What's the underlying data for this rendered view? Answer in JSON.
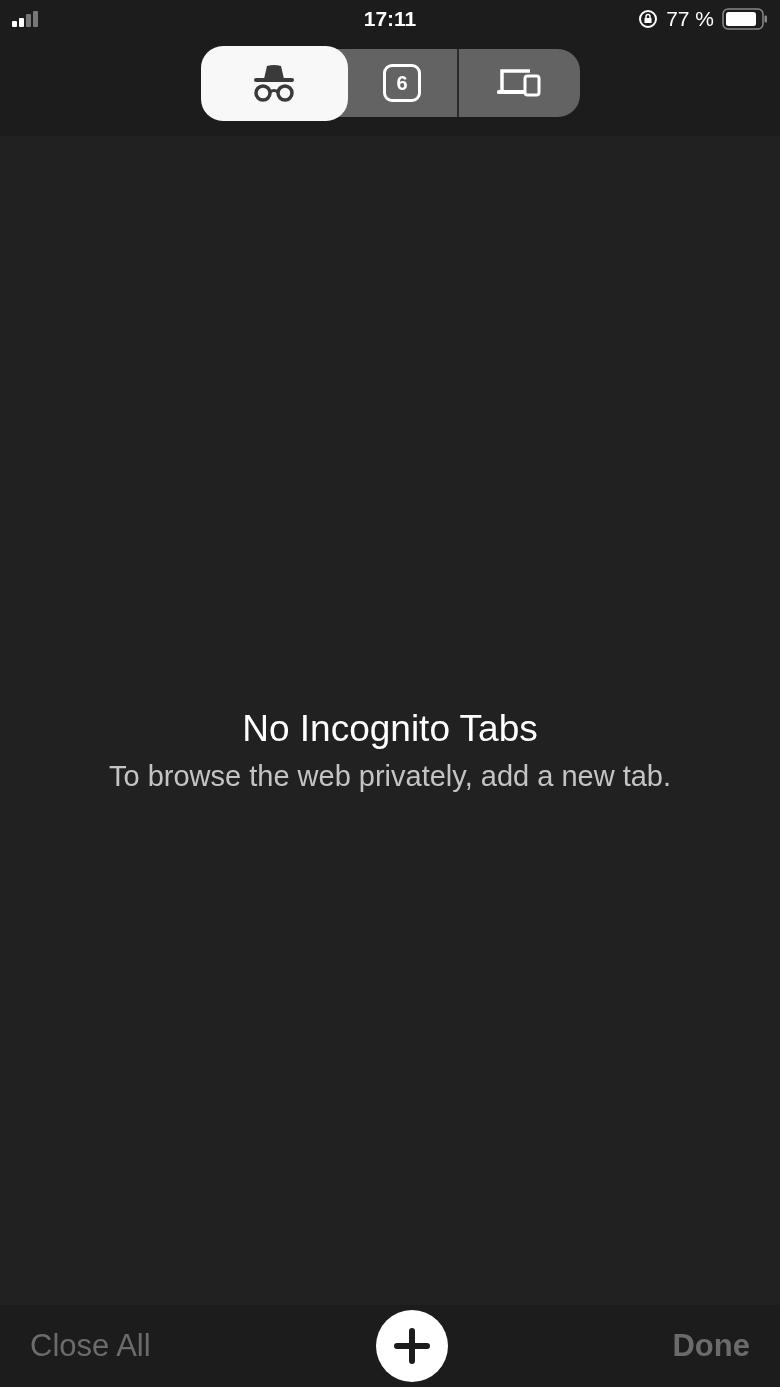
{
  "status_bar": {
    "time": "17:11",
    "battery_percent": "77 %"
  },
  "tabs": [
    {
      "kind": "incognito",
      "selected": true
    },
    {
      "kind": "count",
      "label": "6",
      "selected": false
    },
    {
      "kind": "devices",
      "selected": false
    }
  ],
  "empty_state": {
    "title": "No Incognito Tabs",
    "message": "To browse the web privately, add a new tab."
  },
  "toolbar": {
    "close_all": {
      "label": "Close All",
      "disabled": true
    },
    "done": {
      "label": "Done",
      "disabled": true
    }
  }
}
